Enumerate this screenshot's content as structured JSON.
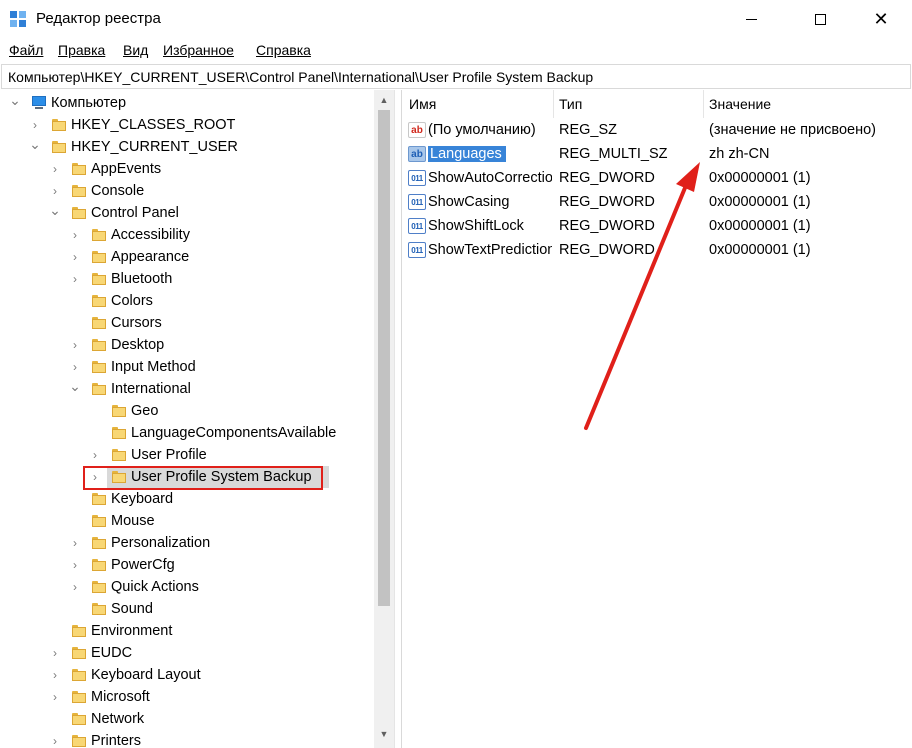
{
  "window": {
    "title": "Редактор реестра",
    "minimize_glyph": "",
    "close_glyph": "✕"
  },
  "menu": [
    "Файл",
    "Правка",
    "Вид",
    "Избранное",
    "Справка"
  ],
  "address": "Компьютер\\HKEY_CURRENT_USER\\Control Panel\\International\\User Profile System Backup",
  "tree": [
    {
      "label": "Компьютер",
      "level": 0,
      "chev": "down",
      "icon": "computer"
    },
    {
      "label": "HKEY_CLASSES_ROOT",
      "level": 1,
      "chev": "right",
      "icon": "folder"
    },
    {
      "label": "HKEY_CURRENT_USER",
      "level": 1,
      "chev": "down",
      "icon": "folder"
    },
    {
      "label": "AppEvents",
      "level": 2,
      "chev": "right",
      "icon": "folder"
    },
    {
      "label": "Console",
      "level": 2,
      "chev": "right",
      "icon": "folder"
    },
    {
      "label": "Control Panel",
      "level": 2,
      "chev": "down",
      "icon": "folder"
    },
    {
      "label": "Accessibility",
      "level": 3,
      "chev": "right",
      "icon": "folder"
    },
    {
      "label": "Appearance",
      "level": 3,
      "chev": "right",
      "icon": "folder"
    },
    {
      "label": "Bluetooth",
      "level": 3,
      "chev": "right",
      "icon": "folder"
    },
    {
      "label": "Colors",
      "level": 3,
      "chev": "",
      "icon": "folder"
    },
    {
      "label": "Cursors",
      "level": 3,
      "chev": "",
      "icon": "folder"
    },
    {
      "label": "Desktop",
      "level": 3,
      "chev": "right",
      "icon": "folder"
    },
    {
      "label": "Input Method",
      "level": 3,
      "chev": "right",
      "icon": "folder"
    },
    {
      "label": "International",
      "level": 3,
      "chev": "down",
      "icon": "folder"
    },
    {
      "label": "Geo",
      "level": 4,
      "chev": "",
      "icon": "folder"
    },
    {
      "label": "LanguageComponentsAvailable",
      "level": 4,
      "chev": "",
      "icon": "folder"
    },
    {
      "label": "User Profile",
      "level": 4,
      "chev": "right",
      "icon": "folder"
    },
    {
      "label": "User Profile System Backup",
      "level": 4,
      "chev": "right",
      "icon": "folder",
      "selected": true
    },
    {
      "label": "Keyboard",
      "level": 3,
      "chev": "",
      "icon": "folder"
    },
    {
      "label": "Mouse",
      "level": 3,
      "chev": "",
      "icon": "folder"
    },
    {
      "label": "Personalization",
      "level": 3,
      "chev": "right",
      "icon": "folder"
    },
    {
      "label": "PowerCfg",
      "level": 3,
      "chev": "right",
      "icon": "folder"
    },
    {
      "label": "Quick Actions",
      "level": 3,
      "chev": "right",
      "icon": "folder"
    },
    {
      "label": "Sound",
      "level": 3,
      "chev": "",
      "icon": "folder"
    },
    {
      "label": "Environment",
      "level": 2,
      "chev": "",
      "icon": "folder"
    },
    {
      "label": "EUDC",
      "level": 2,
      "chev": "right",
      "icon": "folder"
    },
    {
      "label": "Keyboard Layout",
      "level": 2,
      "chev": "right",
      "icon": "folder"
    },
    {
      "label": "Microsoft",
      "level": 2,
      "chev": "right",
      "icon": "folder"
    },
    {
      "label": "Network",
      "level": 2,
      "chev": "",
      "icon": "folder"
    },
    {
      "label": "Printers",
      "level": 2,
      "chev": "right",
      "icon": "folder"
    }
  ],
  "columns": {
    "name": "Имя",
    "type": "Тип",
    "value": "Значение"
  },
  "values": [
    {
      "icon": "string-value-icon",
      "icon_text": "ab",
      "name": "(По умолчанию)",
      "type": "REG_SZ",
      "data": "(значение не присвоено)"
    },
    {
      "icon": "multi-string-value-icon",
      "icon_text": "ab",
      "name": "Languages",
      "type": "REG_MULTI_SZ",
      "data": "zh zh-CN",
      "selected": true
    },
    {
      "icon": "dword-value-icon",
      "icon_text": "011",
      "name": "ShowAutoCorrection",
      "type": "REG_DWORD",
      "data": "0x00000001 (1)"
    },
    {
      "icon": "dword-value-icon",
      "icon_text": "011",
      "name": "ShowCasing",
      "type": "REG_DWORD",
      "data": "0x00000001 (1)"
    },
    {
      "icon": "dword-value-icon",
      "icon_text": "011",
      "name": "ShowShiftLock",
      "type": "REG_DWORD",
      "data": "0x00000001 (1)"
    },
    {
      "icon": "dword-value-icon",
      "icon_text": "011",
      "name": "ShowTextPrediction",
      "type": "REG_DWORD",
      "data": "0x00000001 (1)"
    }
  ],
  "colors": {
    "selection_blue": "#3884d8",
    "highlight_red": "#e0201a",
    "folder_yellow": "#f8d775"
  },
  "scrollbar": {
    "up_glyph": "▲",
    "down_glyph": "▼"
  }
}
